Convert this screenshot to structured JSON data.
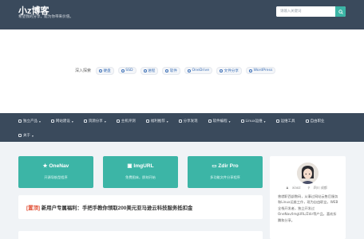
{
  "header": {
    "site_title": "小z博客",
    "site_desc": "希望我的分享，能为你带来价值。",
    "search_placeholder": "请输入关键词"
  },
  "tag_strip": {
    "label": "深入探索",
    "tags": [
      "硬盘",
      "SSD",
      "进程",
      "软件",
      "OneDrive",
      "文件分享",
      "WordPress"
    ]
  },
  "nav": {
    "row1": [
      "独立产品",
      "网站建设",
      "资源分享",
      "主机评测",
      "福利推荐",
      "分享发现",
      "软件编程",
      "Linux运维",
      "运维工具",
      "自由职业"
    ],
    "row1_caret": [
      true,
      true,
      true,
      false,
      true,
      false,
      true,
      true,
      false,
      false
    ],
    "row2": [
      "关于"
    ],
    "row2_caret": [
      true
    ]
  },
  "cards": [
    {
      "title": "OneNav",
      "sub": "开源导航型程序"
    },
    {
      "title": "ImgURL",
      "sub": "免费图床，即刻开始"
    },
    {
      "title": "Zdir Pro",
      "sub": "多功能文件分享程序"
    }
  ],
  "notice": {
    "tag": "[置顶]",
    "text": "新用户专属福利：手把手教你领取200美元亚马逊云科技服务抵扣金"
  },
  "profile": {
    "name": "xiaoz",
    "location": "四川 成都",
    "bio": "曾就职西部数码，从事过网站云售后服务和Linux运维工作，现为自由职业，WEB全栈开发者，独立开发过OneNav/ImgURL/Zdir等产品，喜欢折腾和分享。"
  },
  "colors": {
    "header_bg": "#3a4a5c",
    "accent": "#3cb5a6",
    "link": "#3b6fb6",
    "top_tag": "#e04a2f"
  }
}
